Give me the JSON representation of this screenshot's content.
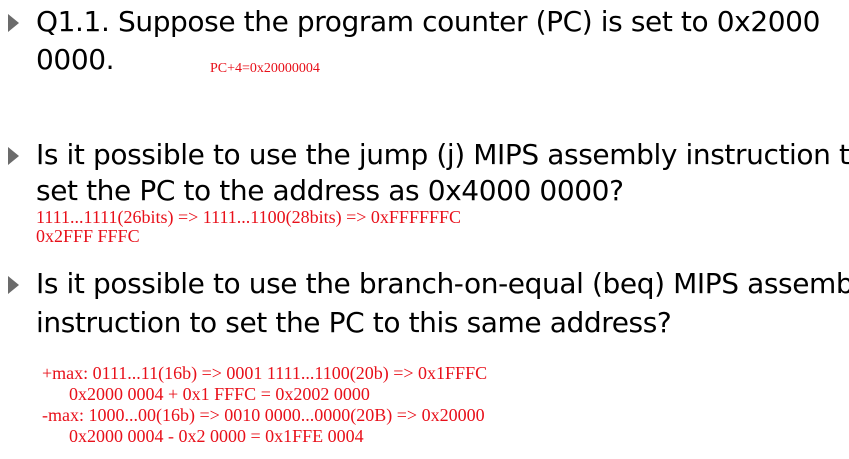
{
  "colors": {
    "text": "#000000",
    "annotation": "#e8101a",
    "bullet": "#6b6b6b"
  },
  "icons": [
    "triangle-bullet-icon"
  ],
  "slide": {
    "q1": {
      "line1": "Q1.1. Suppose the program counter (PC) is set to 0x2000",
      "line2": "0000.",
      "note": "PC+4=0x20000004"
    },
    "jump": {
      "line1": "Is it possible to use the jump (j) MIPS assembly instruction to",
      "line2": "set the PC to the address as 0x4000 0000?",
      "note1": "1111...1111(26bits) => 1111...1100(28bits) => 0xFFFFFFC",
      "note2": "0x2FFF FFFC"
    },
    "beq": {
      "line1": "Is it possible to use the branch-on-equal (beq) MIPS assembly",
      "line2": "instruction to set the PC to this same address?",
      "work": [
        "+max: 0111...11(16b) => 0001 1111...1100(20b) => 0x1FFFC",
        "      0x2000 0004 + 0x1 FFFC = 0x2002 0000",
        "-max: 1000...00(16b) => 0010 0000...0000(20B) => 0x20000",
        "      0x2000 0004 - 0x2 0000 = 0x1FFE 0004"
      ]
    }
  }
}
